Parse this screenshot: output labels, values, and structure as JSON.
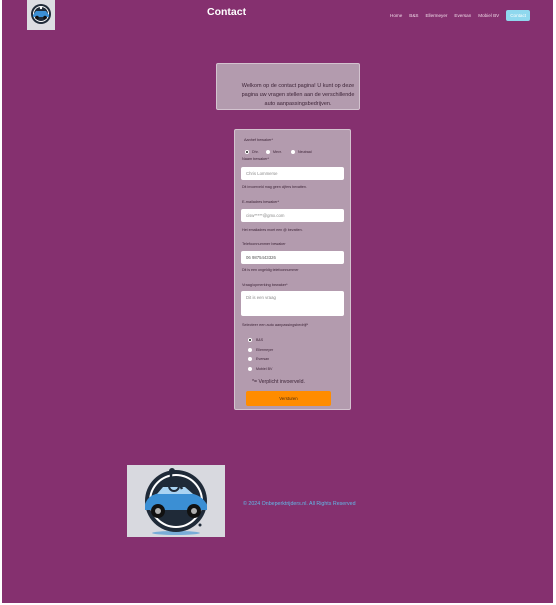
{
  "header": {
    "title": "Contact",
    "nav": [
      "Home",
      "B&S",
      "Ellermeyer",
      "Eversan",
      "Mobiel BV"
    ],
    "nav_active": "Contact"
  },
  "welcome": {
    "text": "Welkom op de contact pagina! U kunt op deze pagina uw vragen stellen aan de verschillende auto aanpassingsbedrijven."
  },
  "form": {
    "salutation_label": "Aanhef bewaker*",
    "salutation_options": [
      "Dhr.",
      "Mevr.",
      "Neutraal"
    ],
    "salutation_selected": "Dhr.",
    "name_label": "Naam bewaker*",
    "name_placeholder": "Chris Lommerse",
    "name_hint": "Dit invoerveld mag geen cijfers bevatten.",
    "email_label": "E-mailadres bewaker*",
    "email_placeholder": "cisw*****@gmx.com",
    "email_hint": "Het emailadres moet een @ bevatten.",
    "phone_label": "Telefoonnummer bewaker",
    "phone_value": "06 9875443326",
    "phone_hint": "Dit is een ongeldig telefoonnummer",
    "question_label": "Vraag/opmerking bewaker*",
    "question_placeholder": "Dit is een vraag",
    "company_label": "Selecteer een auto aanpassingsbedrijf*",
    "company_options": [
      "B&S",
      "Ellermeyer",
      "Eversan",
      "Mobiel BV"
    ],
    "company_selected": "B&S",
    "required_note": "*= Verplicht invoerveld.",
    "submit_label": "Versturen"
  },
  "footer": {
    "copyright": "© 2024 Onbeperktrijders.nl. All Rights Reserved"
  },
  "colors": {
    "background": "#85306f",
    "card": "#b39bae",
    "accent_button": "#ff8c00",
    "active_nav": "#8fd8ee",
    "copyright": "#62b9e8"
  }
}
